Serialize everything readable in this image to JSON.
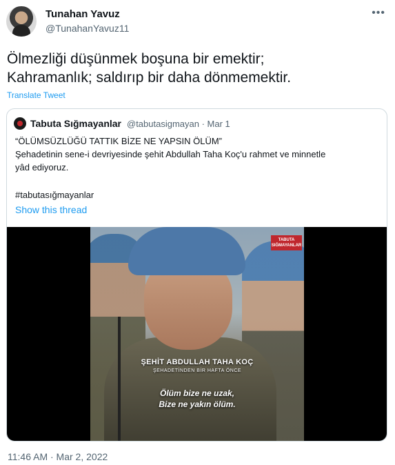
{
  "author": {
    "name": "Tunahan Yavuz",
    "handle": "@TunahanYavuz11"
  },
  "tweet": {
    "lines": [
      "Ölmezliği düşünmek boşuna bir emektir;",
      "Kahramanlık; saldırıp bir daha dönmemektir."
    ],
    "translate_label": "Translate Tweet",
    "timestamp": "11:46 AM · Mar 2, 2022"
  },
  "quote": {
    "name": "Tabuta Sığmayanlar",
    "meta": "@tabutasigmayan · Mar 1",
    "body_lines": [
      "“ÖLÜMSÜZLÜĞÜ TATTIK BİZE NE YAPSIN ÖLÜM”",
      "Şehadetinin sene-i devriyesinde şehit Abdullah Taha Koç'u rahmet ve minnetle",
      "yâd ediyoruz."
    ],
    "hashtag": "#tabutasığmayanlar",
    "show_thread_label": "Show this thread"
  },
  "video": {
    "logo_text": "TABUTA SIĞMAYANLAR",
    "caption_name": "ŞEHİT ABDULLAH TAHA KOÇ",
    "caption_sub": "ŞEHADETİNDEN BİR HAFTA ÖNCE",
    "subtitle_lines": [
      "Ölüm bize ne uzak,",
      "Bize ne yakın ölüm."
    ]
  },
  "icons": {
    "more": "more-icon",
    "avatar": "avatar-image",
    "quote_avatar": "quote-avatar-image"
  },
  "colors": {
    "link": "#1d9bf0",
    "secondary": "#536471",
    "text": "#0f1419",
    "border": "#cfd9de"
  }
}
